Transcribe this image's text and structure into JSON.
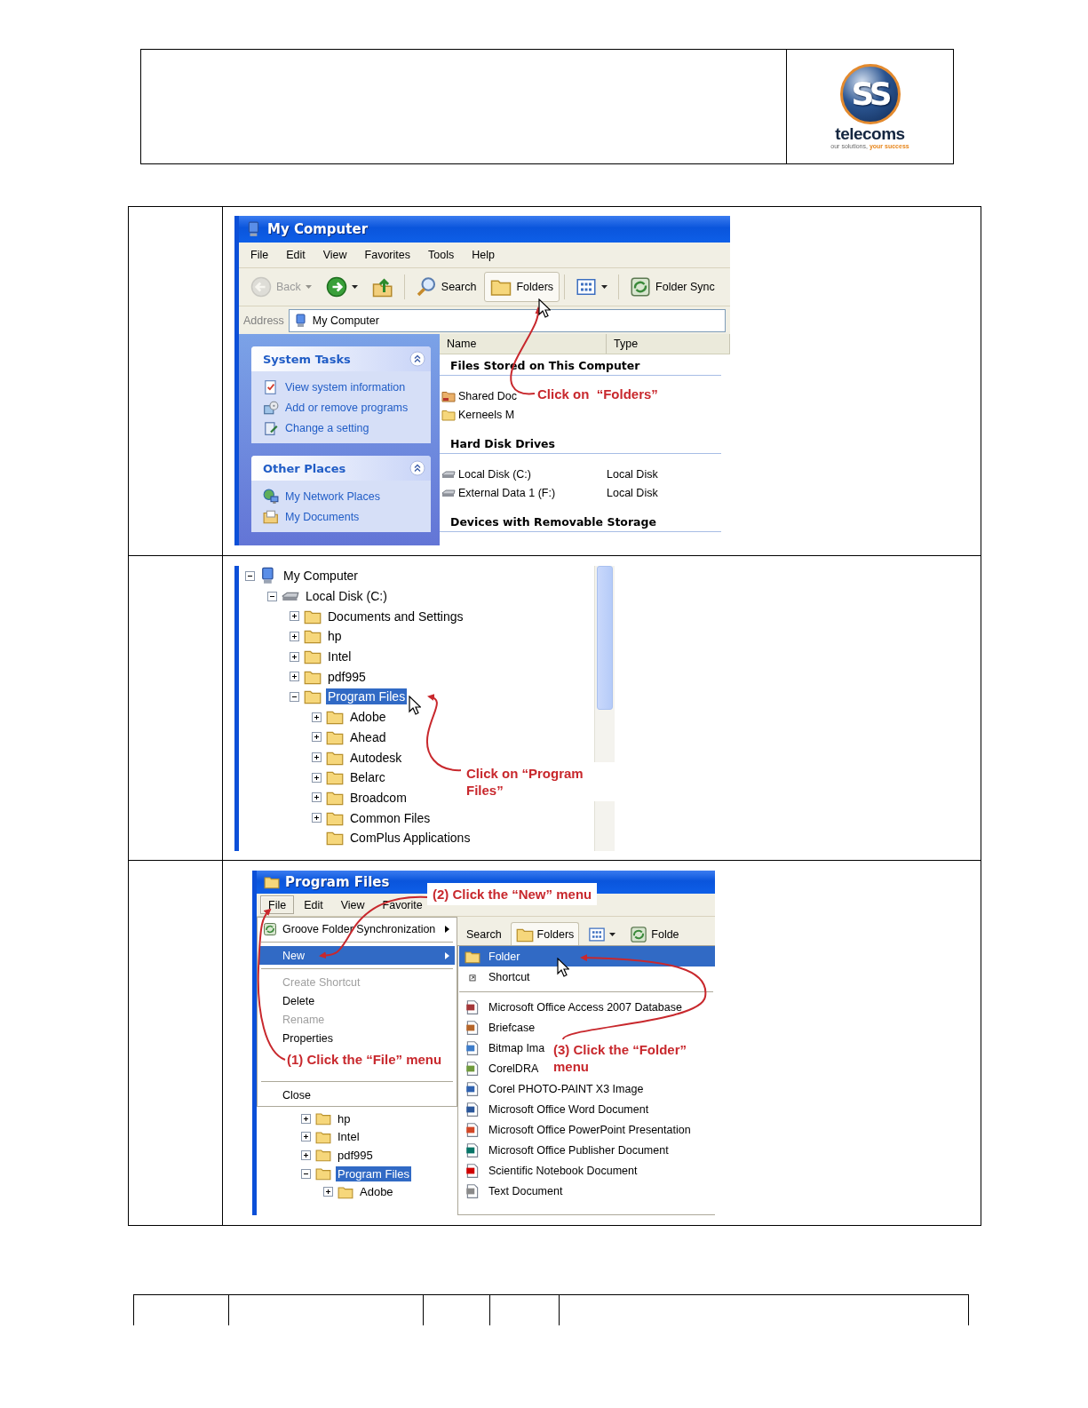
{
  "header": {
    "logo": {
      "emblem": "SS",
      "name": "telecoms",
      "tagline": "our solutions,",
      "tagline_accent": "your success"
    }
  },
  "steps": [
    {
      "kind": "explorer",
      "window": {
        "title": "My Computer",
        "menu": [
          "File",
          "Edit",
          "View",
          "Favorites",
          "Tools",
          "Help"
        ],
        "toolbar": [
          {
            "kind": "back",
            "label": "Back",
            "disabled": true,
            "selected": false
          },
          {
            "kind": "forward",
            "disabled": false,
            "selected": false
          },
          {
            "kind": "up",
            "disabled": false,
            "selected": false
          },
          {
            "kind": "search",
            "label": "Search",
            "disabled": false,
            "selected": false
          },
          {
            "kind": "folders",
            "label": "Folders",
            "disabled": false,
            "selected": true
          },
          {
            "kind": "views",
            "disabled": false,
            "selected": false
          },
          {
            "kind": "sync",
            "label": "Folder Sync",
            "disabled": false,
            "selected": false
          }
        ],
        "address": {
          "label": "Address",
          "value": "My Computer"
        },
        "panels": [
          {
            "title": "System Tasks",
            "items": [
              {
                "kind": "info",
                "label": "View system information"
              },
              {
                "kind": "addremove",
                "label": "Add or remove programs"
              },
              {
                "kind": "setting",
                "label": "Change a setting"
              }
            ]
          },
          {
            "title": "Other Places",
            "items": [
              {
                "kind": "network",
                "label": "My Network Places"
              },
              {
                "kind": "docs",
                "label": "My Documents"
              }
            ]
          }
        ],
        "columns": [
          "Name",
          "Type"
        ],
        "groups": [
          {
            "title": "Files Stored on This Computer",
            "items": [
              {
                "kind": "shared",
                "name": "Shared Doc"
              },
              {
                "kind": "folder",
                "name": "Kerneels M"
              }
            ]
          },
          {
            "title": "Hard Disk Drives",
            "items": [
              {
                "kind": "disk",
                "name": "Local Disk (C:)",
                "type": "Local Disk"
              },
              {
                "kind": "disk",
                "name": "External Data 1 (F:)",
                "type": "Local Disk"
              }
            ]
          },
          {
            "title": "Devices with Removable Storage"
          }
        ]
      },
      "callout": "Click on  “Folders”"
    },
    {
      "kind": "tree",
      "tree": [
        {
          "kind": "computer",
          "label": "My Computer",
          "expanded": true,
          "selected": false,
          "children": [
            {
              "kind": "disk",
              "label": "Local Disk (C:)",
              "expanded": true,
              "selected": false,
              "children": [
                {
                  "kind": "folder",
                  "label": "Documents and Settings",
                  "expanded": false,
                  "selected": false
                },
                {
                  "kind": "folder",
                  "label": "hp",
                  "expanded": false,
                  "selected": false
                },
                {
                  "kind": "folder",
                  "label": "Intel",
                  "expanded": false,
                  "selected": false
                },
                {
                  "kind": "folder",
                  "label": "pdf995",
                  "expanded": false,
                  "selected": false
                },
                {
                  "kind": "folder",
                  "label": "Program Files",
                  "expanded": true,
                  "selected": true,
                  "children": [
                    {
                      "kind": "folder",
                      "label": "Adobe",
                      "expanded": false,
                      "selected": false
                    },
                    {
                      "kind": "folder",
                      "label": "Ahead",
                      "expanded": false,
                      "selected": false
                    },
                    {
                      "kind": "folder",
                      "label": "Autodesk",
                      "expanded": false,
                      "selected": false
                    },
                    {
                      "kind": "folder",
                      "label": "Belarc",
                      "expanded": false,
                      "selected": false
                    },
                    {
                      "kind": "folder",
                      "label": "Broadcom",
                      "expanded": false,
                      "selected": false
                    },
                    {
                      "kind": "folder",
                      "label": "Common Files",
                      "expanded": false,
                      "selected": false
                    },
                    {
                      "kind": "folder",
                      "label": "ComPlus Applications",
                      "selected": false
                    }
                  ]
                }
              ]
            }
          ]
        }
      ],
      "callout": "Click on “Program Files”"
    },
    {
      "kind": "menu",
      "window": {
        "title": "Program Files",
        "menu": [
          {
            "label": "File",
            "selected": true
          },
          {
            "label": "Edit",
            "selected": false
          },
          {
            "label": "View",
            "selected": false
          },
          {
            "label": "Favorite",
            "selected": false
          }
        ],
        "toolbar": [
          {
            "kind": "search",
            "label": "Search",
            "selected": false
          },
          {
            "kind": "folders",
            "label": "Folders",
            "selected": true
          },
          {
            "kind": "views",
            "selected": false
          },
          {
            "kind": "sync",
            "label": "Folde",
            "selected": false
          }
        ],
        "file_menu": [
          {
            "kind": "sync",
            "label": "Groove Folder Synchronization",
            "has_submenu": true,
            "selected": false,
            "disabled": false
          },
          {
            "kind": "separator"
          },
          {
            "kind": "item",
            "label": "New",
            "has_submenu": true,
            "selected": true,
            "disabled": false
          },
          {
            "kind": "separator"
          },
          {
            "kind": "item",
            "label": "Create Shortcut",
            "has_submenu": false,
            "selected": false,
            "disabled": true
          },
          {
            "kind": "item",
            "label": "Delete",
            "has_submenu": false,
            "selected": false,
            "disabled": false
          },
          {
            "kind": "item",
            "label": "Rename",
            "has_submenu": false,
            "selected": false,
            "disabled": true
          },
          {
            "kind": "item",
            "label": "Properties",
            "has_submenu": false,
            "selected": false,
            "disabled": false
          },
          {
            "kind": "separator"
          },
          {
            "kind": "item",
            "label": "Close",
            "has_submenu": false,
            "selected": false,
            "disabled": false
          }
        ],
        "submenu": [
          {
            "kind": "folder",
            "label": "Folder",
            "selected": true
          },
          {
            "kind": "shortcut",
            "label": "Shortcut",
            "selected": false
          },
          {
            "kind": "separator"
          },
          {
            "kind": "access",
            "label": "Microsoft Office Access 2007 Database",
            "selected": false
          },
          {
            "kind": "briefcase",
            "label": "Briefcase",
            "selected": false
          },
          {
            "kind": "bitmap",
            "label": "Bitmap Ima",
            "selected": false
          },
          {
            "kind": "corel",
            "label": "CorelDRA",
            "selected": false
          },
          {
            "kind": "photopaint",
            "label": "Corel PHOTO-PAINT X3 Image",
            "selected": false
          },
          {
            "kind": "word",
            "label": "Microsoft Office Word Document",
            "selected": false
          },
          {
            "kind": "powerpoint",
            "label": "Microsoft Office PowerPoint Presentation",
            "selected": false
          },
          {
            "kind": "publisher",
            "label": "Microsoft Office Publisher Document",
            "selected": false
          },
          {
            "kind": "notebook",
            "label": "Scientific Notebook Document",
            "selected": false
          },
          {
            "kind": "text",
            "label": "Text Document",
            "selected": false
          }
        ],
        "tree": [
          {
            "kind": "folder",
            "label": "hp",
            "expanded": false,
            "selected": false
          },
          {
            "kind": "folder",
            "label": "Intel",
            "expanded": false,
            "selected": false
          },
          {
            "kind": "folder",
            "label": "pdf995",
            "expanded": false,
            "selected": false
          },
          {
            "kind": "folder",
            "label": "Program Files",
            "expanded": true,
            "selected": true,
            "children": [
              {
                "kind": "folder",
                "label": "Adobe",
                "expanded": false,
                "selected": false
              }
            ]
          }
        ]
      },
      "callouts": [
        "(1) Click the “File” menu",
        "(2) Click the “New” menu",
        "(3) Click the “Folder” menu"
      ]
    }
  ]
}
